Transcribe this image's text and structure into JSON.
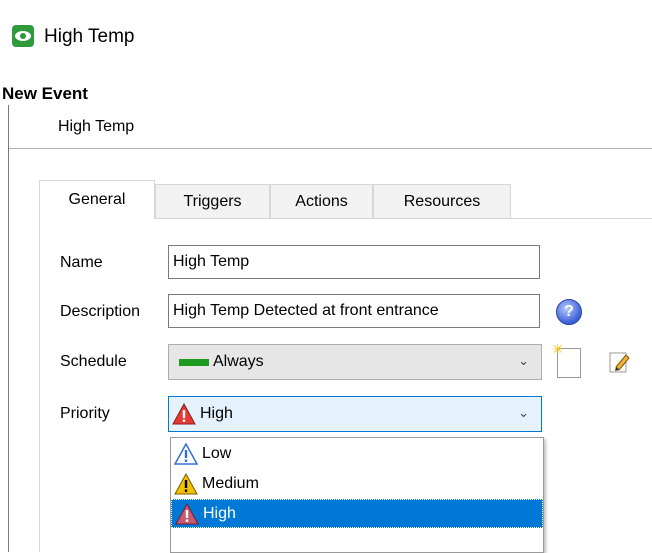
{
  "window": {
    "title": "High Temp",
    "icon": "eye-icon"
  },
  "section": {
    "title": "New Event",
    "subtitle": "High Temp"
  },
  "tabs": [
    {
      "label": "General",
      "active": true
    },
    {
      "label": "Triggers",
      "active": false
    },
    {
      "label": "Actions",
      "active": false
    },
    {
      "label": "Resources",
      "active": false
    }
  ],
  "form": {
    "name_label": "Name",
    "name_value": "High Temp",
    "description_label": "Description",
    "description_value": "High Temp Detected at front entrance",
    "schedule_label": "Schedule",
    "schedule_value": "Always",
    "priority_label": "Priority",
    "priority_value": "High"
  },
  "priority_options": [
    {
      "label": "Low",
      "color": "#2f6fd6"
    },
    {
      "label": "Medium",
      "color": "#f2c200"
    },
    {
      "label": "High",
      "color": "#e53935",
      "selected": true
    }
  ],
  "icons": {
    "help": "help-icon",
    "new_schedule": "new-schedule-icon",
    "edit_schedule": "edit-schedule-icon"
  }
}
